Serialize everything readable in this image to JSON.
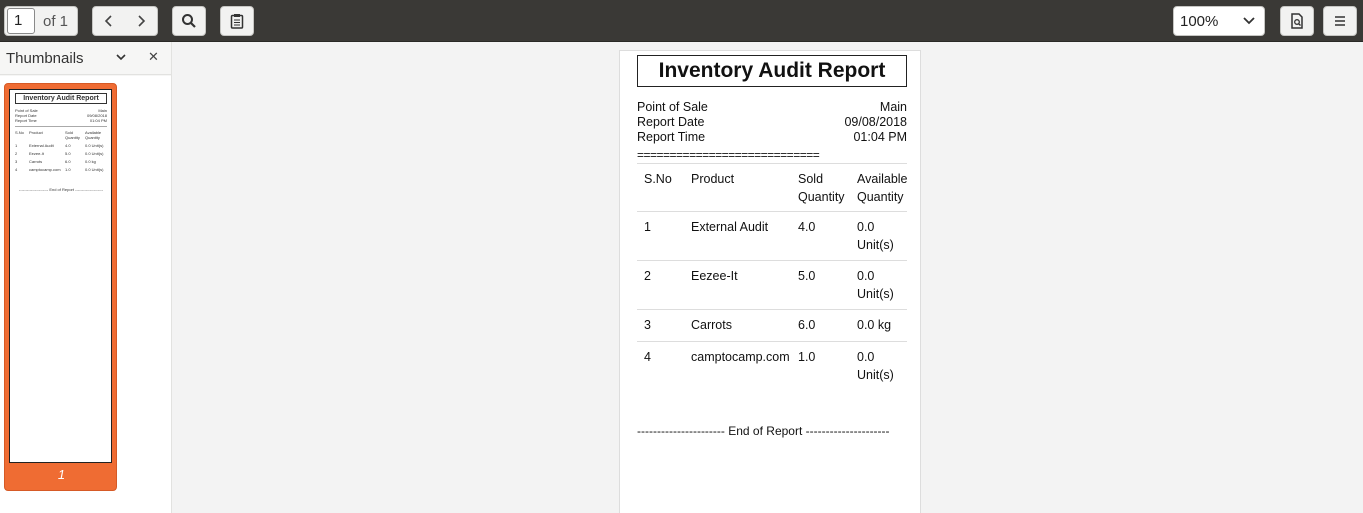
{
  "toolbar": {
    "page_current": "1",
    "page_total": "of 1",
    "zoom": "100%"
  },
  "sidebar": {
    "title": "Thumbnails",
    "thumb_page_number": "1"
  },
  "report": {
    "title": "Inventory Audit Report",
    "meta": [
      {
        "label": "Point of Sale",
        "value": "Main"
      },
      {
        "label": "Report Date",
        "value": "09/08/2018"
      },
      {
        "label": "Report Time",
        "value": "01:04 PM"
      }
    ],
    "separator": "============================",
    "columns": [
      "S.No",
      "Product",
      "Sold Quantity",
      "Available Quantity"
    ],
    "rows": [
      {
        "sno": "1",
        "product": "External Audit",
        "sold": "4.0",
        "available": "0.0 Unit(s)"
      },
      {
        "sno": "2",
        "product": "Eezee-It",
        "sold": "5.0",
        "available": "0.0 Unit(s)"
      },
      {
        "sno": "3",
        "product": "Carrots",
        "sold": "6.0",
        "available": "0.0 kg"
      },
      {
        "sno": "4",
        "product": "camptocamp.com",
        "sold": "1.0",
        "available": "0.0 Unit(s)"
      }
    ],
    "end_text": "---------------------- End of Report ---------------------"
  },
  "colors": {
    "toolbar_bg": "#3a3936",
    "thumb_selected": "#ef6c33"
  }
}
